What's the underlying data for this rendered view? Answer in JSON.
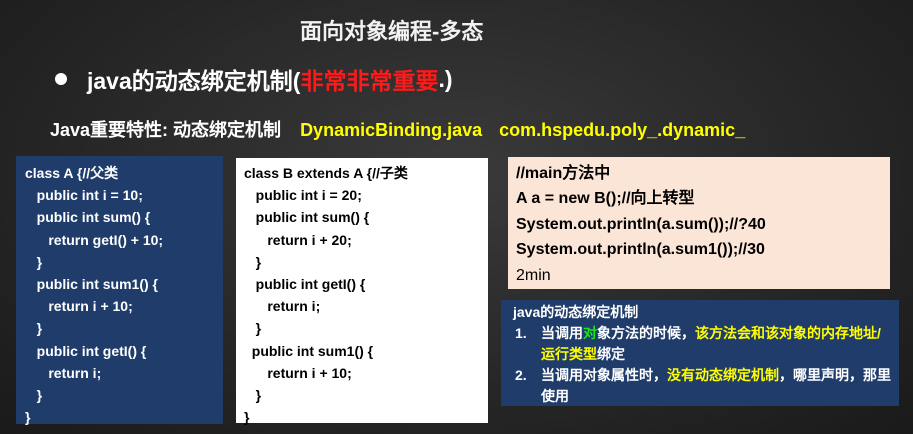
{
  "title": "面向对象编程-多态",
  "bullet": {
    "prefix": "java的动态绑定机制(",
    "emphasis": "非常非常重要",
    "suffix": ".)"
  },
  "feature": {
    "label": "Java重要特性: 动态绑定机制",
    "file": "DynamicBinding.java",
    "package": "com.hspedu.poly_.dynamic_"
  },
  "code_a": [
    "class A {//父类",
    "   public int i = 10;",
    "   public int sum() {",
    "      return getI() + 10;",
    "   }",
    "   public int sum1() {",
    "      return i + 10;",
    "   }",
    "   public int getI() {",
    "      return i;",
    "   }",
    "}"
  ],
  "code_b": [
    "class B extends A {//子类",
    "   public int i = 20;",
    "   public int sum() {",
    "      return i + 20;",
    "   }",
    "   public int getI() {",
    "      return i;",
    "   }",
    "  public int sum1() {",
    "      return i + 10;",
    "   }",
    "}"
  ],
  "main_code": [
    "//main方法中",
    "A a = new B();//向上转型",
    "System.out.println(a.sum());//?40",
    "System.out.println(a.sum1());//30",
    "2min"
  ],
  "notes": {
    "heading": "java的动态绑定机制",
    "item1": {
      "num": "1.",
      "part1": "当调用",
      "part_green": "对",
      "part2": "象方法的时候，",
      "highlight": "该方法会和该对象的内存地址/运行类型",
      "part3": "绑定"
    },
    "item2": {
      "num": "2.",
      "part1": "当调用对象属性时，",
      "highlight": "没有动态绑定机制",
      "part2": "，哪里声明，那里使用"
    }
  }
}
